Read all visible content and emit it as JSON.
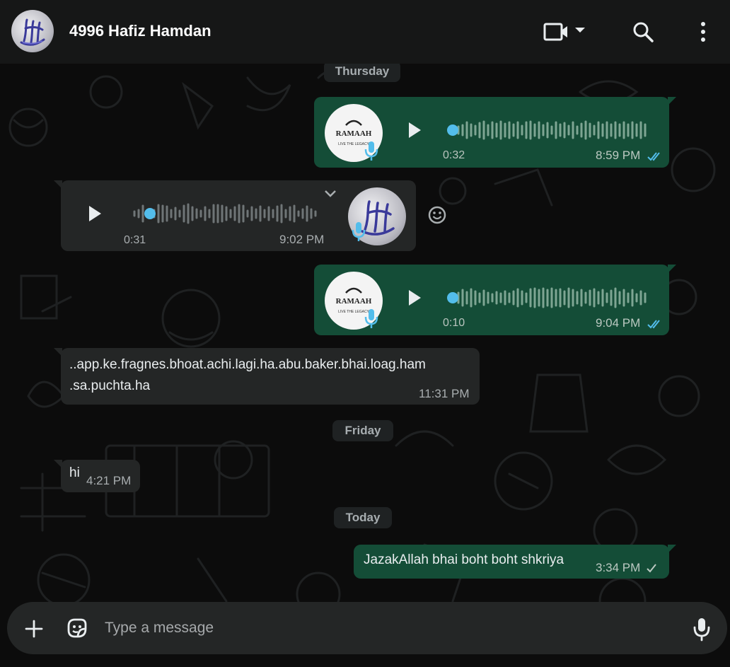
{
  "header": {
    "contact_name": "4996 Hafiz Hamdan",
    "avatar_icon": "calligraphy-avatar-icon",
    "icons": [
      "video-call-icon",
      "chevron-down-icon",
      "search-icon",
      "menu-dots-icon"
    ]
  },
  "chat": {
    "day_dividers": {
      "thursday": "Thursday",
      "friday": "Friday",
      "today": "Today"
    },
    "messages": [
      {
        "direction": "outgoing",
        "type": "voice",
        "duration": "0:32",
        "time": "8:59 PM",
        "status": "read",
        "avatar_label": "RAMAAH",
        "avatar_sub": "LIVE THE LEGACY"
      },
      {
        "direction": "incoming",
        "type": "voice",
        "duration": "0:31",
        "time": "9:02 PM"
      },
      {
        "direction": "outgoing",
        "type": "voice",
        "duration": "0:10",
        "time": "9:04 PM",
        "status": "read",
        "avatar_label": "RAMAAH",
        "avatar_sub": "LIVE THE LEGACY"
      },
      {
        "direction": "incoming",
        "type": "text",
        "text_line1": "..app.ke.fragnes.bhoat.achi.lagi.ha.abu.baker.bhai.loag.ham",
        "text_line2": ".sa.puchta.ha",
        "time": "11:31 PM"
      },
      {
        "direction": "incoming",
        "type": "text",
        "text": "hi",
        "time": "4:21 PM"
      },
      {
        "direction": "outgoing",
        "type": "text",
        "text": "JazakAllah bhai boht boht shkriya",
        "time": "3:34 PM",
        "status": "sent"
      }
    ]
  },
  "composer": {
    "placeholder": "Type a message",
    "icons": [
      "plus-icon",
      "sticker-icon",
      "microphone-icon"
    ]
  },
  "colors": {
    "header_bg": "#161717",
    "outgoing_bubble": "#144d37",
    "incoming_bubble": "#242626",
    "read_ticks": "#53bdeb",
    "play_progress": "#53bdeb"
  }
}
